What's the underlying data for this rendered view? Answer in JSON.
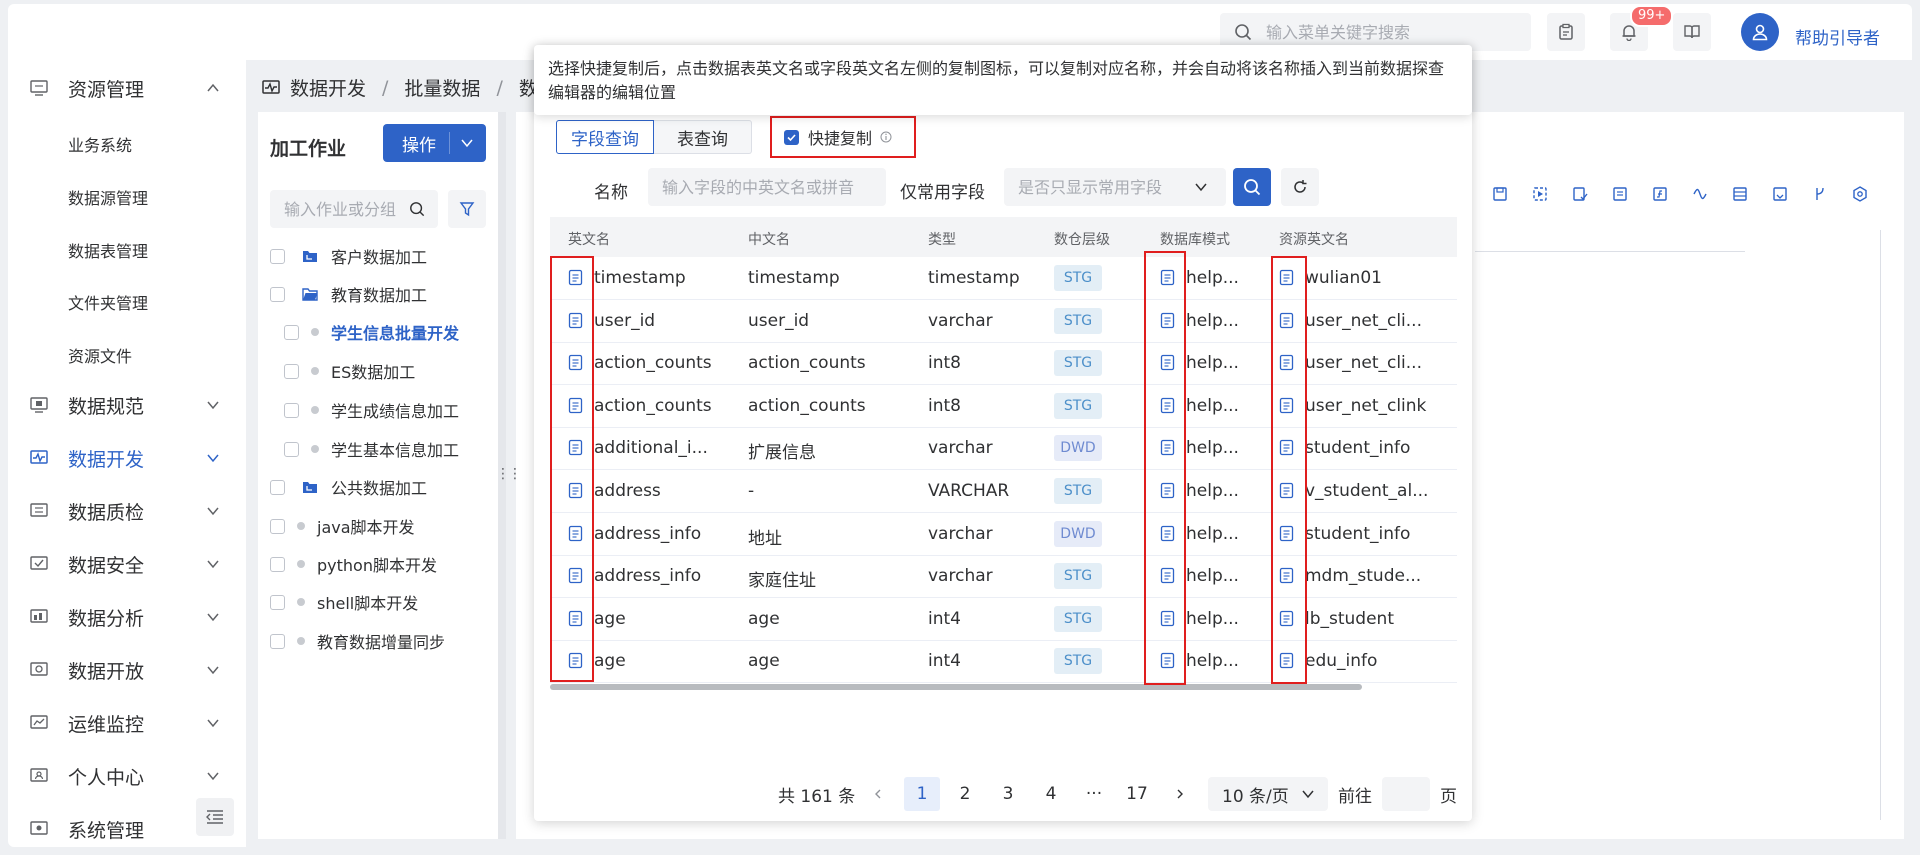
{
  "header": {
    "search_placeholder": "输入菜单关键字搜索",
    "notification_badge": "99+",
    "user_name": "帮助引导者"
  },
  "sidebar": {
    "menus": [
      {
        "label": "资源管理",
        "icon": "monitor-icon",
        "expanded": true
      },
      {
        "label": "数据规范",
        "icon": "screen-icon"
      },
      {
        "label": "数据开发",
        "icon": "pulse-icon",
        "active": true
      },
      {
        "label": "数据质检",
        "icon": "list-icon"
      },
      {
        "label": "数据安全",
        "icon": "check-box-icon"
      },
      {
        "label": "数据分析",
        "icon": "chart-icon"
      },
      {
        "label": "数据开放",
        "icon": "share-icon"
      },
      {
        "label": "运维监控",
        "icon": "line-chart-icon"
      },
      {
        "label": "个人中心",
        "icon": "user-icon"
      },
      {
        "label": "系统管理",
        "icon": "gear-icon"
      }
    ],
    "sub_items": [
      "业务系统",
      "数据源管理",
      "数据表管理",
      "文件夹管理",
      "资源文件"
    ]
  },
  "breadcrumb": [
    "数据开发",
    "批量数据",
    "数"
  ],
  "job_panel": {
    "title": "加工作业",
    "op_label": "操作",
    "search_placeholder": "输入作业或分组",
    "tree": [
      "客户数据加工",
      "教育数据加工",
      "学生信息批量开发",
      "ES数据加工",
      "学生成绩信息加工",
      "学生基本信息加工",
      "公共数据加工",
      "java脚本开发",
      "python脚本开发",
      "shell脚本开发",
      "教育数据增量同步"
    ]
  },
  "popup": {
    "tip": "选择快捷复制后，点击数据表英文名或字段英文名左侧的复制图标，可以复制对应名称，并会自动将该名称插入到当前数据探查编辑器的编辑位置",
    "tabs": [
      "字段查询",
      "表查询"
    ],
    "quick_copy_label": "快捷复制",
    "name_label": "名称",
    "name_placeholder": "输入字段的中英文名或拼音",
    "common_label": "仅常用字段",
    "common_placeholder": "是否只显示常用字段",
    "columns": [
      "英文名",
      "中文名",
      "类型",
      "数仓层级",
      "数据库模式",
      "资源英文名"
    ],
    "rows": [
      {
        "en": "timestamp",
        "cn": "timestamp",
        "type": "timestamp",
        "layer": "STG",
        "schema": "help...",
        "res": "wulian01"
      },
      {
        "en": "user_id",
        "cn": "user_id",
        "type": "varchar",
        "layer": "STG",
        "schema": "help...",
        "res": "user_net_cli..."
      },
      {
        "en": "action_counts",
        "cn": "action_counts",
        "type": "int8",
        "layer": "STG",
        "schema": "help...",
        "res": "user_net_cli..."
      },
      {
        "en": "action_counts",
        "cn": "action_counts",
        "type": "int8",
        "layer": "STG",
        "schema": "help...",
        "res": "user_net_clink"
      },
      {
        "en": "additional_i...",
        "cn": "扩展信息",
        "type": "varchar",
        "layer": "DWD",
        "schema": "help...",
        "res": "student_info"
      },
      {
        "en": "address",
        "cn": "-",
        "type": "VARCHAR",
        "layer": "STG",
        "schema": "help...",
        "res": "v_student_al..."
      },
      {
        "en": "address_info",
        "cn": "地址",
        "type": "varchar",
        "layer": "DWD",
        "schema": "help...",
        "res": "student_info"
      },
      {
        "en": "address_info",
        "cn": "家庭住址",
        "type": "varchar",
        "layer": "STG",
        "schema": "help...",
        "res": "mdm_stude..."
      },
      {
        "en": "age",
        "cn": "age",
        "type": "int4",
        "layer": "STG",
        "schema": "help...",
        "res": "lb_student"
      },
      {
        "en": "age",
        "cn": "age",
        "type": "int4",
        "layer": "STG",
        "schema": "help...",
        "res": "edu_info"
      }
    ],
    "pager": {
      "total": "共 161 条",
      "pages": [
        "1",
        "2",
        "3",
        "4",
        "···",
        "17"
      ],
      "page_size": "10 条/页",
      "goto_label": "前往",
      "page_suffix": "页"
    }
  },
  "colors": {
    "primary": "#2e63c7",
    "highlight": "#e01e1e"
  }
}
